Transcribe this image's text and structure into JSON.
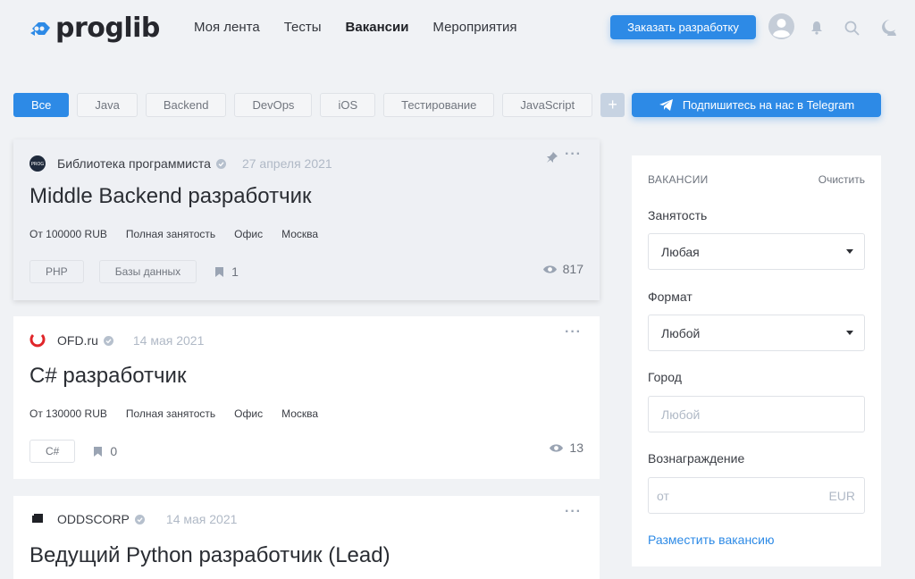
{
  "header": {
    "logo_text": "proglib",
    "nav": [
      "Моя лента",
      "Тесты",
      "Вакансии",
      "Мероприятия"
    ],
    "active_nav": "Вакансии",
    "order_button": "Заказать разработку",
    "icons": [
      "avatar-icon",
      "bell-icon",
      "search-icon",
      "moon-icon"
    ]
  },
  "tags": {
    "items": [
      "Все",
      "Java",
      "Backend",
      "DevOps",
      "iOS",
      "Тестирование",
      "JavaScript"
    ],
    "active": "Все",
    "add_label": "+"
  },
  "telegram_button": "Подпишитесь на нас в Telegram",
  "cards": [
    {
      "company": "Библиотека программиста",
      "date": "27 апреля 2021",
      "title": "Middle Backend разработчик",
      "salary": "От 100000 RUB",
      "employment": "Полная занятость",
      "format": "Офис",
      "city": "Москва",
      "skills": [
        "PHP",
        "Базы данных"
      ],
      "bookmarks": "1",
      "views": "817",
      "pinned": true
    },
    {
      "company": "OFD.ru",
      "date": "14 мая 2021",
      "title": "C# разработчик",
      "salary": "От 130000 RUB",
      "employment": "Полная занятость",
      "format": "Офис",
      "city": "Москва",
      "skills": [
        "C#"
      ],
      "bookmarks": "0",
      "views": "13",
      "pinned": false
    },
    {
      "company": "ODDSCORP",
      "date": "14 мая 2021",
      "title": "Ведущий Python разработчик (Lead)",
      "pinned": false
    }
  ],
  "sidebar": {
    "heading": "ВАКАНСИИ",
    "clear": "Очистить",
    "employment_label": "Занятость",
    "employment_value": "Любая",
    "format_label": "Формат",
    "format_value": "Любой",
    "city_label": "Город",
    "city_placeholder": "Любой",
    "reward_label": "Вознаграждение",
    "reward_placeholder": "от",
    "reward_currency": "EUR",
    "post_link": "Разместить вакансию"
  },
  "colors": {
    "accent": "#2d8ae6",
    "background": "#f0f2f5"
  }
}
